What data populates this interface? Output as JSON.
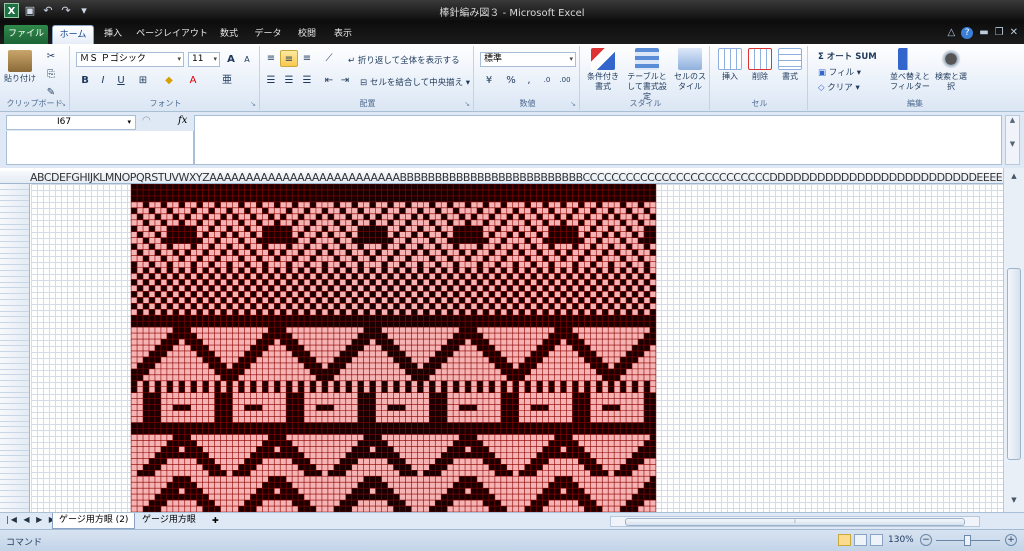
{
  "window": {
    "title": "棒針編み図３ - Microsoft Excel",
    "app_icon_letter": "X"
  },
  "tabs": [
    {
      "label": "ファイル",
      "name": "tab-file"
    },
    {
      "label": "ホーム",
      "name": "tab-home"
    },
    {
      "label": "挿入",
      "name": "tab-insert"
    },
    {
      "label": "ページレイアウト",
      "name": "tab-page-layout"
    },
    {
      "label": "数式",
      "name": "tab-formulas"
    },
    {
      "label": "データ",
      "name": "tab-data"
    },
    {
      "label": "校閲",
      "name": "tab-review"
    },
    {
      "label": "表示",
      "name": "tab-view"
    }
  ],
  "ribbon": {
    "clipboard": {
      "paste": "貼り付け",
      "label": "クリップボード"
    },
    "font": {
      "name": "ＭＳ Ｐゴシック",
      "size": "11",
      "label": "フォント",
      "bold": "B",
      "italic": "I",
      "underline": "U",
      "grow": "A",
      "shrink": "A"
    },
    "alignment": {
      "wrap": "折り返して全体を表示する",
      "merge": "セルを結合して中央揃え",
      "label": "配置"
    },
    "number": {
      "format": "標準",
      "percent": "%",
      "comma": ",",
      "inc_dec": ".0",
      "dec_dec": ".00",
      "label": "数値"
    },
    "styles": {
      "conditional": "条件付き書式",
      "table": "テーブルとして書式設定",
      "cell": "セルのスタイル",
      "label": "スタイル"
    },
    "cells": {
      "insert": "挿入",
      "delete": "削除",
      "format": "書式",
      "label": "セル"
    },
    "editing": {
      "autosum": "Σ オート SUM",
      "fill": "フィル",
      "clear": "クリア",
      "sort": "並べ替えとフィルター",
      "find": "検索と選択",
      "label": "編集"
    }
  },
  "formula_bar": {
    "name_box": "I67",
    "fx": "fx",
    "content": ""
  },
  "grid": {
    "column_headers": "ABCDEFGHIJKLMNOPQRSTUVWXYZAAAAAAAAAAAAAAAAAAAAAAAAAABBBBBBBBBBBBBBBBBBBBBBBBBBCCCCCCCCCCCCCCCCCCCCCCCCCCDDDDDDDDDDDDDDDDDDDDDDDDDDEEEEE",
    "pattern_colors": {
      "dark": "#1a0000",
      "light": "#f6b3b3",
      "line": "#8a0000"
    }
  },
  "sheet_tabs": [
    {
      "label": "ゲージ用方眼 (2)",
      "active": true
    },
    {
      "label": "ゲージ用方眼",
      "active": false
    }
  ],
  "status": {
    "mode": "コマンド",
    "zoom": "130%"
  },
  "colors": {
    "file_tab": "#217346",
    "ribbon_bg": "#dfe9f5"
  }
}
